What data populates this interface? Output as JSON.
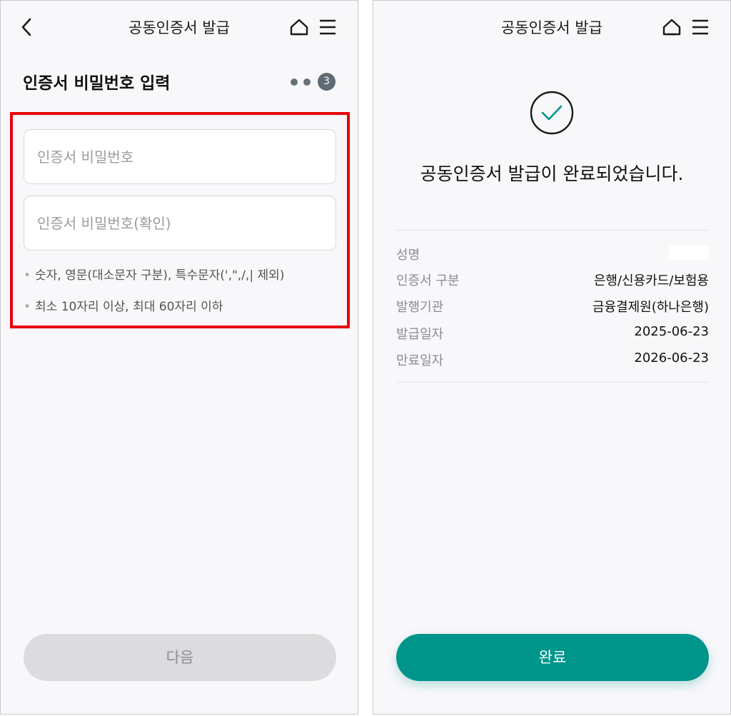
{
  "left_screen": {
    "header_title": "공동인증서 발급",
    "section_title": "인증서 비밀번호 입력",
    "step": "3",
    "password_placeholder": "인증서 비밀번호",
    "password_confirm_placeholder": "인증서 비밀번호(확인)",
    "hints": [
      "숫자, 영문(대소문자 구분), 특수문자(',\",/,| 제외)",
      "최소 10자리 이상, 최대 60자리 이하"
    ],
    "next_button": "다음"
  },
  "right_screen": {
    "header_title": "공동인증서 발급",
    "complete_message": "공동인증서 발급이 완료되었습니다.",
    "info": [
      {
        "label": "성명",
        "value": ""
      },
      {
        "label": "인증서 구분",
        "value": "은행/신용카드/보험용"
      },
      {
        "label": "발행기관",
        "value": "금융결제원(하나은행)"
      },
      {
        "label": "발급일자",
        "value": "2025-06-23"
      },
      {
        "label": "만료일자",
        "value": "2026-06-23"
      }
    ],
    "done_button": "완료"
  },
  "colors": {
    "accent": "#00958b",
    "highlight": "#e8000d",
    "disabled_button": "#dcdcde",
    "background": "#f8f7fa"
  },
  "icons": [
    "back-arrow-icon",
    "home-icon",
    "hamburger-menu-icon",
    "checkmark-circle-icon"
  ]
}
